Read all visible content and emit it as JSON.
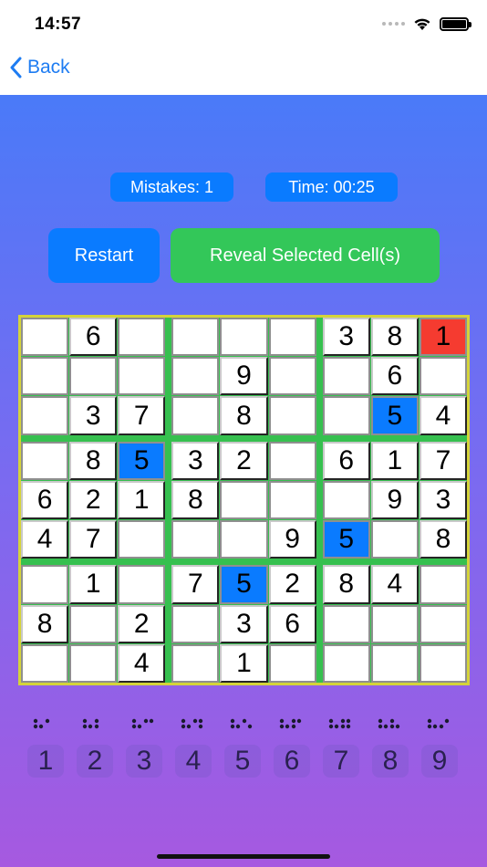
{
  "status": {
    "time": "14:57"
  },
  "nav": {
    "back_label": "Back"
  },
  "stats": {
    "mistakes": "Mistakes: 1",
    "time": "Time: 00:25"
  },
  "buttons": {
    "restart": "Restart",
    "reveal": "Reveal Selected Cell(s)"
  },
  "colors": {
    "accent": "#0a7bff",
    "reveal_green": "#33c759",
    "error_red": "#f53b30",
    "grid_green": "#36c04f",
    "board_border": "#d4d33a"
  },
  "board": [
    [
      "",
      "6",
      "",
      "",
      "",
      "",
      "3",
      "8",
      "1"
    ],
    [
      "",
      "",
      "",
      "",
      "9",
      "",
      "",
      "6",
      ""
    ],
    [
      "",
      "3",
      "7",
      "",
      "8",
      "",
      "",
      "5",
      "4"
    ],
    [
      "",
      "8",
      "5",
      "3",
      "2",
      "",
      "6",
      "1",
      "7"
    ],
    [
      "6",
      "2",
      "1",
      "8",
      "",
      "",
      "",
      "9",
      "3"
    ],
    [
      "4",
      "7",
      "",
      "",
      "",
      "9",
      "5",
      "",
      "8"
    ],
    [
      "",
      "1",
      "",
      "7",
      "5",
      "2",
      "8",
      "4",
      ""
    ],
    [
      "8",
      "",
      "2",
      "",
      "3",
      "6",
      "",
      "",
      ""
    ],
    [
      "",
      "",
      "4",
      "",
      "1",
      "",
      "",
      "",
      ""
    ]
  ],
  "given": [
    [
      0,
      1
    ],
    [
      0,
      6
    ],
    [
      0,
      7
    ],
    [
      1,
      4
    ],
    [
      1,
      7
    ],
    [
      2,
      1
    ],
    [
      2,
      2
    ],
    [
      2,
      4
    ],
    [
      2,
      8
    ],
    [
      3,
      1
    ],
    [
      3,
      3
    ],
    [
      3,
      4
    ],
    [
      3,
      6
    ],
    [
      3,
      7
    ],
    [
      3,
      8
    ],
    [
      4,
      0
    ],
    [
      4,
      1
    ],
    [
      4,
      2
    ],
    [
      4,
      3
    ],
    [
      4,
      7
    ],
    [
      4,
      8
    ],
    [
      5,
      0
    ],
    [
      5,
      1
    ],
    [
      5,
      5
    ],
    [
      5,
      8
    ],
    [
      6,
      1
    ],
    [
      6,
      3
    ],
    [
      6,
      5
    ],
    [
      6,
      6
    ],
    [
      6,
      7
    ],
    [
      7,
      0
    ],
    [
      7,
      2
    ],
    [
      7,
      4
    ],
    [
      7,
      5
    ],
    [
      8,
      2
    ],
    [
      8,
      4
    ]
  ],
  "selected_cells": [
    [
      2,
      7
    ],
    [
      3,
      2
    ],
    [
      5,
      6
    ],
    [
      6,
      4
    ]
  ],
  "error_cells": [
    [
      0,
      8
    ]
  ],
  "number_pad": [
    {
      "value": "1",
      "braille": [
        1
      ]
    },
    {
      "value": "2",
      "braille": [
        1,
        2
      ]
    },
    {
      "value": "3",
      "braille": [
        1,
        4
      ]
    },
    {
      "value": "4",
      "braille": [
        1,
        4,
        5
      ]
    },
    {
      "value": "5",
      "braille": [
        1,
        5
      ]
    },
    {
      "value": "6",
      "braille": [
        1,
        2,
        4
      ]
    },
    {
      "value": "7",
      "braille": [
        1,
        2,
        4,
        5
      ]
    },
    {
      "value": "8",
      "braille": [
        1,
        2,
        5
      ]
    },
    {
      "value": "9",
      "braille": [
        2,
        4
      ]
    }
  ]
}
